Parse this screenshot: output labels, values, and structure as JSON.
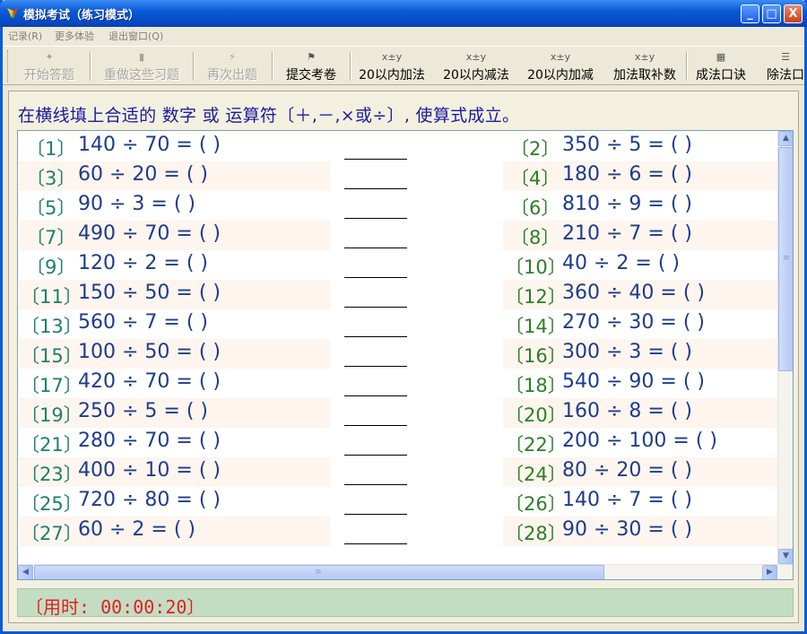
{
  "window": {
    "title": "模拟考试（练习模式）"
  },
  "titlebar_buttons": {
    "minimize": "_",
    "maximize": "□",
    "close": "X"
  },
  "menu": [
    {
      "label": "记录(R)"
    },
    {
      "label": "更多体验"
    },
    {
      "label": "退出窗口(Q)"
    }
  ],
  "toolbar": [
    {
      "label": "开始答题",
      "icon": "pin-icon",
      "glyph": "✦",
      "disabled": true
    },
    {
      "label": "重做这些习题",
      "icon": "doc-icon",
      "glyph": "▮",
      "disabled": true
    },
    {
      "label": "再次出题",
      "icon": "bolt-icon",
      "glyph": "⚡",
      "disabled": true
    },
    {
      "label": "提交考卷",
      "icon": "flag-icon",
      "glyph": "⚑",
      "disabled": false
    },
    {
      "label": "20以内加法",
      "icon": "xy-icon",
      "glyph": "x±y",
      "disabled": false
    },
    {
      "label": "20以内减法",
      "icon": "xy-icon",
      "glyph": "x±y",
      "disabled": false
    },
    {
      "label": "20以内加减",
      "icon": "xy-icon",
      "glyph": "x±y",
      "disabled": false
    },
    {
      "label": "加法取补数",
      "icon": "xy-icon",
      "glyph": "x±y",
      "disabled": false
    },
    {
      "label": "成法口诀",
      "icon": "calculator-icon",
      "glyph": "▦",
      "disabled": false
    },
    {
      "label": "除法口",
      "icon": "list-icon",
      "glyph": "☰",
      "disabled": false
    }
  ],
  "instruction": "在横线填上合适的 数字 或 运算符〔＋,－,×或÷〕, 使算式成立。",
  "problems": {
    "left": [
      {
        "num": "〔1〕",
        "expr": "140 ÷ 70 = (    )"
      },
      {
        "num": "〔3〕",
        "expr": "60 ÷ 20 = (    )"
      },
      {
        "num": "〔5〕",
        "expr": "90 ÷ 3 = (    )"
      },
      {
        "num": "〔7〕",
        "expr": "490 ÷ 70 = (    )"
      },
      {
        "num": "〔9〕",
        "expr": "120 ÷ 2 = (    )"
      },
      {
        "num": "〔11〕",
        "expr": "150 ÷ 50 = (    )"
      },
      {
        "num": "〔13〕",
        "expr": "560 ÷ 7 = (    )"
      },
      {
        "num": "〔15〕",
        "expr": "100 ÷ 50 = (    )"
      },
      {
        "num": "〔17〕",
        "expr": "420 ÷ 70 = (    )"
      },
      {
        "num": "〔19〕",
        "expr": "250 ÷ 5 = (    )"
      },
      {
        "num": "〔21〕",
        "expr": "280 ÷ 70 = (    )"
      },
      {
        "num": "〔23〕",
        "expr": "400 ÷ 10 = (    )"
      },
      {
        "num": "〔25〕",
        "expr": "720 ÷ 80 = (    )"
      },
      {
        "num": "〔27〕",
        "expr": "60 ÷ 2 = (    )"
      }
    ],
    "right": [
      {
        "num": "〔2〕",
        "expr": "350 ÷ 5 = (    )"
      },
      {
        "num": "〔4〕",
        "expr": "180 ÷ 6 = (    )"
      },
      {
        "num": "〔6〕",
        "expr": "810 ÷ 9 = (    )"
      },
      {
        "num": "〔8〕",
        "expr": "210 ÷ 7 = (    )"
      },
      {
        "num": "〔10〕",
        "expr": "40 ÷ 2 = (    )"
      },
      {
        "num": "〔12〕",
        "expr": "360 ÷ 40 = (    )"
      },
      {
        "num": "〔14〕",
        "expr": "270 ÷ 30 = (    )"
      },
      {
        "num": "〔16〕",
        "expr": "300 ÷ 3 = (    )"
      },
      {
        "num": "〔18〕",
        "expr": "540 ÷ 90 = (    )"
      },
      {
        "num": "〔20〕",
        "expr": "160 ÷ 8 = (    )"
      },
      {
        "num": "〔22〕",
        "expr": "200 ÷ 100 = (    )"
      },
      {
        "num": "〔24〕",
        "expr": "80 ÷ 20 = (    )"
      },
      {
        "num": "〔26〕",
        "expr": "140 ÷ 7 = (    )"
      },
      {
        "num": "〔28〕",
        "expr": "90 ÷ 30 = (    )"
      }
    ]
  },
  "scroll": {
    "up": "▲",
    "down": "▼",
    "left": "◀",
    "right": "▶",
    "grip": "≡"
  },
  "status": {
    "timer": "〔用时: 00:00:20〕"
  },
  "colors": {
    "title_bar": "#0a5bd6",
    "instruction": "#1a1aa0",
    "expr": "#1c3c8c",
    "num_left": "#1d7f6d",
    "num_right": "#2b7f25",
    "status_bg": "#c3ddc3",
    "timer": "#e02020"
  }
}
